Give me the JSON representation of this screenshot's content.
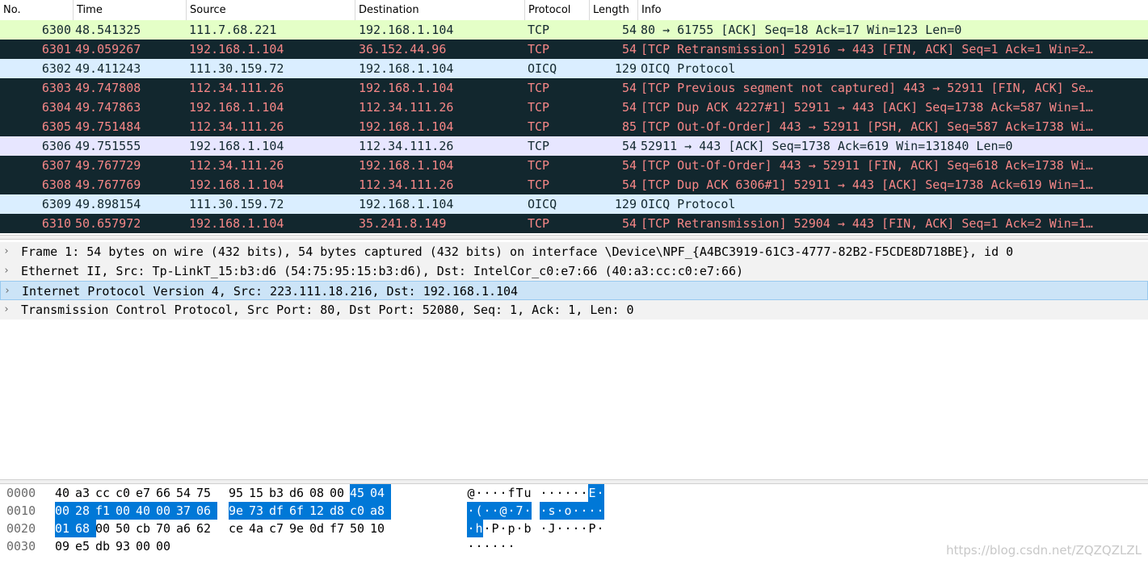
{
  "columns": [
    "No.",
    "Time",
    "Source",
    "Destination",
    "Protocol",
    "Length",
    "Info"
  ],
  "packets": [
    {
      "no": "6300",
      "time": "48.541325",
      "src": "111.7.68.221",
      "dst": "192.168.1.104",
      "proto": "TCP",
      "len": "54",
      "info": "80 → 61755 [ACK] Seq=18 Ack=17 Win=123 Len=0",
      "style": "ack"
    },
    {
      "no": "6301",
      "time": "49.059267",
      "src": "192.168.1.104",
      "dst": "36.152.44.96",
      "proto": "TCP",
      "len": "54",
      "info": "[TCP Retransmission] 52916 → 443 [FIN, ACK] Seq=1 Ack=1 Win=2…",
      "style": "bad"
    },
    {
      "no": "6302",
      "time": "49.411243",
      "src": "111.30.159.72",
      "dst": "192.168.1.104",
      "proto": "OICQ",
      "len": "129",
      "info": "OICQ Protocol",
      "style": "oicq"
    },
    {
      "no": "6303",
      "time": "49.747808",
      "src": "112.34.111.26",
      "dst": "192.168.1.104",
      "proto": "TCP",
      "len": "54",
      "info": "[TCP Previous segment not captured] 443 → 52911 [FIN, ACK] Se…",
      "style": "bad"
    },
    {
      "no": "6304",
      "time": "49.747863",
      "src": "192.168.1.104",
      "dst": "112.34.111.26",
      "proto": "TCP",
      "len": "54",
      "info": "[TCP Dup ACK 4227#1] 52911 → 443 [ACK] Seq=1738 Ack=587 Win=1…",
      "style": "bad"
    },
    {
      "no": "6305",
      "time": "49.751484",
      "src": "112.34.111.26",
      "dst": "192.168.1.104",
      "proto": "TCP",
      "len": "85",
      "info": "[TCP Out-Of-Order] 443 → 52911 [PSH, ACK] Seq=587 Ack=1738 Wi…",
      "style": "bad"
    },
    {
      "no": "6306",
      "time": "49.751555",
      "src": "192.168.1.104",
      "dst": "112.34.111.26",
      "proto": "TCP",
      "len": "54",
      "info": "52911 → 443 [ACK] Seq=1738 Ack=619 Win=131840 Len=0",
      "style": "tcp"
    },
    {
      "no": "6307",
      "time": "49.767729",
      "src": "112.34.111.26",
      "dst": "192.168.1.104",
      "proto": "TCP",
      "len": "54",
      "info": "[TCP Out-Of-Order] 443 → 52911 [FIN, ACK] Seq=618 Ack=1738 Wi…",
      "style": "bad"
    },
    {
      "no": "6308",
      "time": "49.767769",
      "src": "192.168.1.104",
      "dst": "112.34.111.26",
      "proto": "TCP",
      "len": "54",
      "info": "[TCP Dup ACK 6306#1] 52911 → 443 [ACK] Seq=1738 Ack=619 Win=1…",
      "style": "bad"
    },
    {
      "no": "6309",
      "time": "49.898154",
      "src": "111.30.159.72",
      "dst": "192.168.1.104",
      "proto": "OICQ",
      "len": "129",
      "info": "OICQ Protocol",
      "style": "oicq"
    },
    {
      "no": "6310",
      "time": "50.657972",
      "src": "192.168.1.104",
      "dst": "35.241.8.149",
      "proto": "TCP",
      "len": "54",
      "info": "[TCP Retransmission] 52904 → 443 [FIN, ACK] Seq=1 Ack=2 Win=1…",
      "style": "bad"
    }
  ],
  "details": [
    {
      "text": "Frame 1: 54 bytes on wire (432 bits), 54 bytes captured (432 bits) on interface \\Device\\NPF_{A4BC3919-61C3-4777-82B2-F5CDE8D718BE}, id 0",
      "selected": false
    },
    {
      "text": "Ethernet II, Src: Tp-LinkT_15:b3:d6 (54:75:95:15:b3:d6), Dst: IntelCor_c0:e7:66 (40:a3:cc:c0:e7:66)",
      "selected": false
    },
    {
      "text": "Internet Protocol Version 4, Src: 223.111.18.216, Dst: 192.168.1.104",
      "selected": true
    },
    {
      "text": "Transmission Control Protocol, Src Port: 80, Dst Port: 52080, Seq: 1, Ack: 1, Len: 0",
      "selected": false
    }
  ],
  "bytes": [
    {
      "offset": "0000",
      "hex": [
        "40",
        "a3",
        "cc",
        "c0",
        "e7",
        "66",
        "54",
        "75",
        "95",
        "15",
        "b3",
        "d6",
        "08",
        "00",
        "45",
        "04"
      ],
      "ascii": [
        "@",
        "·",
        "·",
        "·",
        "·",
        "f",
        "T",
        "u",
        "·",
        "·",
        "·",
        "·",
        "·",
        "·",
        "E",
        "·"
      ]
    },
    {
      "offset": "0010",
      "hex": [
        "00",
        "28",
        "f1",
        "00",
        "40",
        "00",
        "37",
        "06",
        "9e",
        "73",
        "df",
        "6f",
        "12",
        "d8",
        "c0",
        "a8"
      ],
      "ascii": [
        "·",
        "(",
        "·",
        "·",
        "@",
        "·",
        "7",
        "·",
        "·",
        "s",
        "·",
        "o",
        "·",
        "·",
        "·",
        "·"
      ]
    },
    {
      "offset": "0020",
      "hex": [
        "01",
        "68",
        "00",
        "50",
        "cb",
        "70",
        "a6",
        "62",
        "ce",
        "4a",
        "c7",
        "9e",
        "0d",
        "f7",
        "50",
        "10"
      ],
      "ascii": [
        "·",
        "h",
        "·",
        "P",
        "·",
        "p",
        "·",
        "b",
        "·",
        "J",
        "·",
        "·",
        "·",
        "·",
        "P",
        "·"
      ]
    },
    {
      "offset": "0030",
      "hex": [
        "09",
        "e5",
        "db",
        "93",
        "00",
        "00"
      ],
      "ascii": [
        "·",
        "·",
        "·",
        "·",
        "·",
        "·"
      ]
    }
  ],
  "highlight": {
    "start": 14,
    "end": 33
  },
  "watermark": "https://blog.csdn.net/ZQZQZLZL",
  "icons": {
    "collapsed": "chevron-right-icon"
  },
  "colors": {
    "ack_bg": "#e4ffc7",
    "bad_bg": "#12272e",
    "bad_fg": "#f78787",
    "oicq_bg": "#daeeff",
    "tcp_bg": "#e7e6ff",
    "select_bg": "#cce4f7",
    "byte_hl": "#0078d7"
  }
}
